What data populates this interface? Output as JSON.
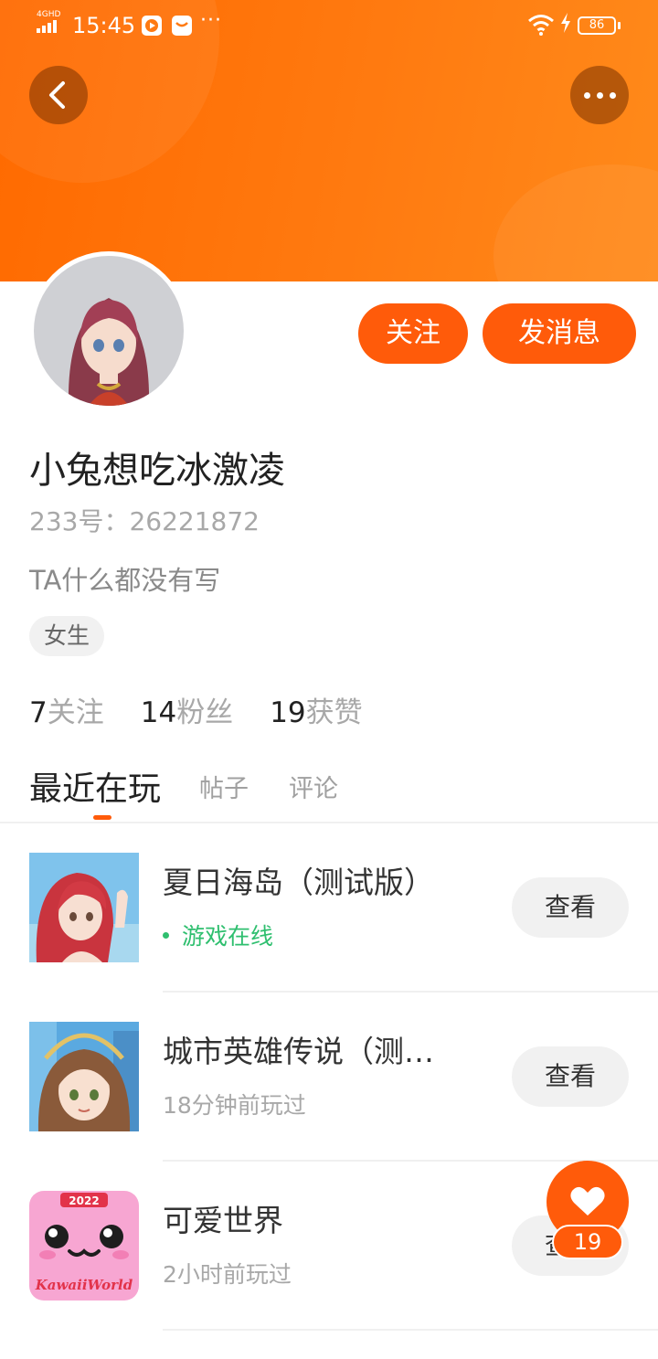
{
  "status_bar": {
    "network": "4GHD",
    "time": "15:45",
    "more_indicator": "···",
    "battery": "86",
    "icons": [
      "signal-icon",
      "video-app-icon",
      "message-app-icon",
      "wifi-icon",
      "charging-icon",
      "battery-icon"
    ]
  },
  "header": {
    "gradient_colors": [
      "#ff6a00",
      "#ff8a1a"
    ],
    "icons": [
      "back-icon",
      "more-icon"
    ]
  },
  "profile": {
    "avatar_icon": "avatar",
    "follow_label": "关注",
    "message_label": "发消息",
    "name": "小兔想吃冰激凌",
    "uid": "233号：26221872",
    "bio": "TA什么都没有写",
    "tag": "女生",
    "stats": [
      {
        "num": "7",
        "label": "关注"
      },
      {
        "num": "14",
        "label": "粉丝"
      },
      {
        "num": "19",
        "label": "获赞"
      }
    ]
  },
  "tabs": [
    {
      "label": "最近在玩",
      "active": true
    },
    {
      "label": "帖子",
      "active": false
    },
    {
      "label": "评论",
      "active": false
    }
  ],
  "games": [
    {
      "title": "夏日海岛（测试版）",
      "subtitle": "游戏在线",
      "online": true,
      "button": "查看"
    },
    {
      "title": "城市英雄传说（测…",
      "subtitle": "18分钟前玩过",
      "online": false,
      "button": "查看"
    },
    {
      "title": "可爱世界",
      "subtitle": "2小时前玩过",
      "online": false,
      "button": "查看",
      "icon_text": [
        "2022",
        "KawaiiWorld"
      ]
    }
  ],
  "like_fab": {
    "count": "19",
    "icon": "heart-icon"
  },
  "colors": {
    "accent": "#ff5b0a",
    "online": "#2fbf6f"
  }
}
